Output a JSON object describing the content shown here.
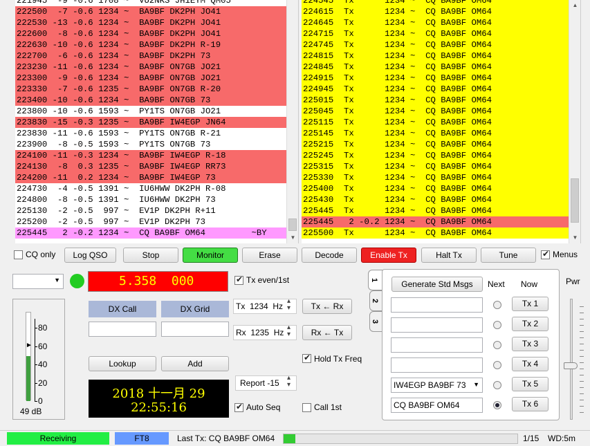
{
  "band_activity": {
    "lines": [
      {
        "text": "221945  -9 -0.6 1708 ~  VU2NKS JH1EYM QM05",
        "color": "white"
      },
      {
        "text": "222500  -7 -0.6 1234 ~  BA9BF DK2PH JO41",
        "color": "red"
      },
      {
        "text": "222530 -13 -0.6 1234 ~  BA9BF DK2PH JO41",
        "color": "red"
      },
      {
        "text": "222600  -8 -0.6 1234 ~  BA9BF DK2PH JO41",
        "color": "red"
      },
      {
        "text": "222630 -10 -0.6 1234 ~  BA9BF DK2PH R-19",
        "color": "red"
      },
      {
        "text": "222700  -6 -0.6 1234 ~  BA9BF DK2PH 73",
        "color": "red"
      },
      {
        "text": "223230 -11 -0.6 1234 ~  BA9BF ON7GB JO21",
        "color": "red"
      },
      {
        "text": "223300  -9 -0.6 1234 ~  BA9BF ON7GB JO21",
        "color": "red"
      },
      {
        "text": "223330  -7 -0.6 1235 ~  BA9BF ON7GB R-20",
        "color": "red"
      },
      {
        "text": "223400 -10 -0.6 1234 ~  BA9BF ON7GB 73",
        "color": "red"
      },
      {
        "text": "223800 -10 -0.6 1593 ~  PY1TS ON7GB JO21",
        "color": "white"
      },
      {
        "text": "223830 -15 -0.3 1235 ~  BA9BF IW4EGP JN64",
        "color": "red"
      },
      {
        "text": "223830 -11 -0.6 1593 ~  PY1TS ON7GB R-21",
        "color": "white"
      },
      {
        "text": "223900  -8 -0.5 1593 ~  PY1TS ON7GB 73",
        "color": "white"
      },
      {
        "text": "224100 -11 -0.3 1234 ~  BA9BF IW4EGP R-18",
        "color": "red"
      },
      {
        "text": "224130  -8  0.3 1235 ~  BA9BF IW4EGP RR73",
        "color": "red"
      },
      {
        "text": "224200 -11  0.2 1234 ~  BA9BF IW4EGP 73",
        "color": "red"
      },
      {
        "text": "224730  -4 -0.5 1391 ~  IU6HWW DK2PH R-08",
        "color": "white"
      },
      {
        "text": "224800  -8 -0.5 1391 ~  IU6HWW DK2PH 73",
        "color": "white"
      },
      {
        "text": "225130  -2 -0.5  997 ~  EV1P DK2PH R+11",
        "color": "white"
      },
      {
        "text": "225200  -2 -0.5  997 ~  EV1P DK2PH 73",
        "color": "white"
      },
      {
        "text": "225445   2 -0.2 1234 ~  CQ BA9BF OM64         ~BY",
        "color": "pink"
      }
    ]
  },
  "rx_frequency": {
    "lines": [
      {
        "text": "224545  Tx      1234 ~  CQ BA9BF OM64",
        "color": "yellow"
      },
      {
        "text": "224615  Tx      1234 ~  CQ BA9BF OM64",
        "color": "yellow"
      },
      {
        "text": "224645  Tx      1234 ~  CQ BA9BF OM64",
        "color": "yellow"
      },
      {
        "text": "224715  Tx      1234 ~  CQ BA9BF OM64",
        "color": "yellow"
      },
      {
        "text": "224745  Tx      1234 ~  CQ BA9BF OM64",
        "color": "yellow"
      },
      {
        "text": "224815  Tx      1234 ~  CQ BA9BF OM64",
        "color": "yellow"
      },
      {
        "text": "224845  Tx      1234 ~  CQ BA9BF OM64",
        "color": "yellow"
      },
      {
        "text": "224915  Tx      1234 ~  CQ BA9BF OM64",
        "color": "yellow"
      },
      {
        "text": "224945  Tx      1234 ~  CQ BA9BF OM64",
        "color": "yellow"
      },
      {
        "text": "225015  Tx      1234 ~  CQ BA9BF OM64",
        "color": "yellow"
      },
      {
        "text": "225045  Tx      1234 ~  CQ BA9BF OM64",
        "color": "yellow"
      },
      {
        "text": "225115  Tx      1234 ~  CQ BA9BF OM64",
        "color": "yellow"
      },
      {
        "text": "225145  Tx      1234 ~  CQ BA9BF OM64",
        "color": "yellow"
      },
      {
        "text": "225215  Tx      1234 ~  CQ BA9BF OM64",
        "color": "yellow"
      },
      {
        "text": "225245  Tx      1234 ~  CQ BA9BF OM64",
        "color": "yellow"
      },
      {
        "text": "225315  Tx      1234 ~  CQ BA9BF OM64",
        "color": "yellow"
      },
      {
        "text": "225330  Tx      1234 ~  CQ BA9BF OM64",
        "color": "yellow"
      },
      {
        "text": "225400  Tx      1234 ~  CQ BA9BF OM64",
        "color": "yellow"
      },
      {
        "text": "225430  Tx      1234 ~  CQ BA9BF OM64",
        "color": "yellow"
      },
      {
        "text": "225445  Tx      1234 ~  CQ BA9BF OM64",
        "color": "yellow"
      },
      {
        "text": "225445   2 -0.2 1234 ~  CQ BA9BF OM64",
        "color": "red"
      },
      {
        "text": "225500  Tx      1234 ~  CQ BA9BF OM64",
        "color": "yellow"
      }
    ]
  },
  "controls": {
    "cq_only": "CQ only",
    "log_qso": "Log QSO",
    "stop": "Stop",
    "monitor": "Monitor",
    "erase": "Erase",
    "decode": "Decode",
    "enable_tx": "Enable Tx",
    "halt_tx": "Halt Tx",
    "tune": "Tune",
    "menus": "Menus"
  },
  "freq_display": "5.358  000",
  "tx_even": "Tx even/1st",
  "dx_call_label": "DX Call",
  "dx_grid_label": "DX Grid",
  "dx_call_value": "",
  "dx_grid_value": "",
  "tx_hz": "Tx  1234  Hz",
  "rx_hz": "Rx  1235  Hz",
  "tx_rx_btn": "Tx ← Rx",
  "rx_tx_btn": "Rx ← Tx",
  "lookup": "Lookup",
  "add": "Add",
  "hold_tx_freq": "Hold Tx Freq",
  "report": "Report -15",
  "auto_seq": "Auto Seq",
  "call_1st": "Call 1st",
  "clock": {
    "date": "2018 十一月 29",
    "time": "22:55:16"
  },
  "meter": {
    "ticks": [
      "80",
      "60",
      "40",
      "20",
      "0"
    ],
    "level_db": "49 dB",
    "level_value": 49,
    "peak_value": 60
  },
  "tabs": [
    "1",
    "2",
    "3"
  ],
  "messages": {
    "generate": "Generate Std Msgs",
    "next_label": "Next",
    "now_label": "Now",
    "pwr_label": "Pwr",
    "rows": [
      {
        "text": "",
        "button": "Tx 1",
        "selected": false
      },
      {
        "text": "",
        "button": "Tx 2",
        "selected": false
      },
      {
        "text": "",
        "button": "Tx 3",
        "selected": false
      },
      {
        "text": "",
        "button": "Tx 4",
        "selected": false
      },
      {
        "text": "IW4EGP BA9BF 73",
        "button": "Tx 5",
        "selected": false
      },
      {
        "text": "CQ BA9BF OM64",
        "button": "Tx 6",
        "selected": true
      }
    ]
  },
  "status": {
    "receiving": "Receiving",
    "mode": "FT8",
    "last_tx": "Last Tx: CQ BA9BF OM64",
    "page": "1/15",
    "wd": "WD:5m",
    "progress": 0.05
  },
  "colors": {
    "red_line": "#f76a6a",
    "yellow_line": "#ffff00",
    "pink_line": "#ff99ff",
    "monitor_green": "#44dd44",
    "enable_tx_red": "#ee2222",
    "receiving_green": "#22ee44",
    "mode_blue": "#6699ff",
    "dx_label_bg": "#aab8d8"
  }
}
